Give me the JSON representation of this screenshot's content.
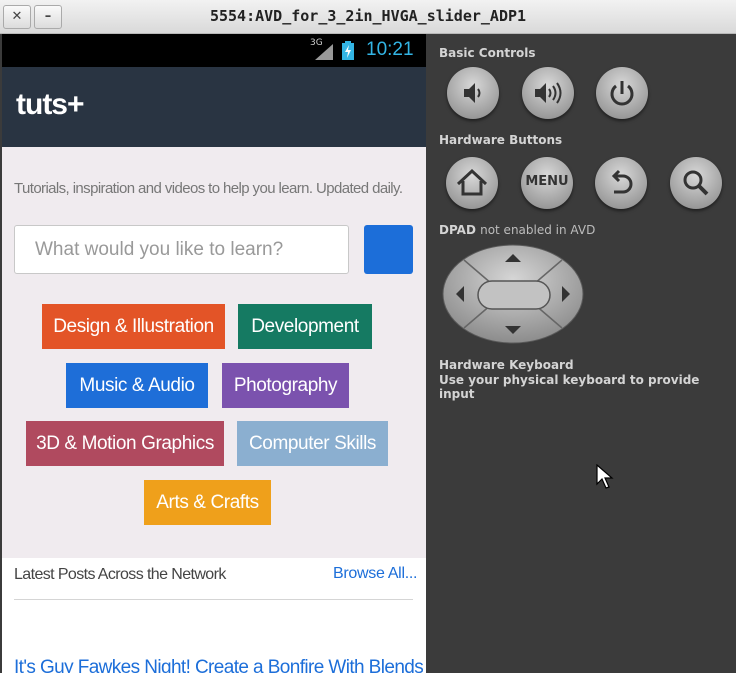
{
  "window": {
    "title": "5554:AVD_for_3_2in_HVGA_slider_ADP1",
    "close_glyph": "✕",
    "minimize_glyph": "–"
  },
  "status_bar": {
    "network": "3G",
    "time": "10:21",
    "time_color": "#33b5e5"
  },
  "site": {
    "logo": "tuts+",
    "tagline": "Tutorials, inspiration and videos to help you learn. Updated daily.",
    "search_placeholder": "What would you like to learn?",
    "categories": [
      {
        "label": "Design & Illustration",
        "color": "#e35427"
      },
      {
        "label": "Development",
        "color": "#157a62"
      },
      {
        "label": "Music & Audio",
        "color": "#1e6ed8"
      },
      {
        "label": "Photography",
        "color": "#7b52ae"
      },
      {
        "label": "3D & Motion Graphics",
        "color": "#b04a5f"
      },
      {
        "label": "Computer Skills",
        "color": "#8bafd0"
      },
      {
        "label": "Arts & Crafts",
        "color": "#efa01b"
      }
    ],
    "latest_title": "Latest Posts Across the Network",
    "browse_all": "Browse All...",
    "first_post": "It's Guy Fawkes Night! Create a Bonfire With Blends"
  },
  "controls": {
    "basic_controls_label": "Basic Controls",
    "basic_buttons": [
      "volume-down-icon",
      "volume-up-icon",
      "power-icon"
    ],
    "hardware_buttons_label": "Hardware Buttons",
    "hardware_buttons": [
      "home-icon",
      "menu-button",
      "back-icon",
      "search-icon"
    ],
    "menu_label": "MENU",
    "dpad_label": "DPAD",
    "dpad_note": "not enabled in AVD",
    "keyboard_title": "Hardware Keyboard",
    "keyboard_text": "Use your physical keyboard to provide input"
  }
}
